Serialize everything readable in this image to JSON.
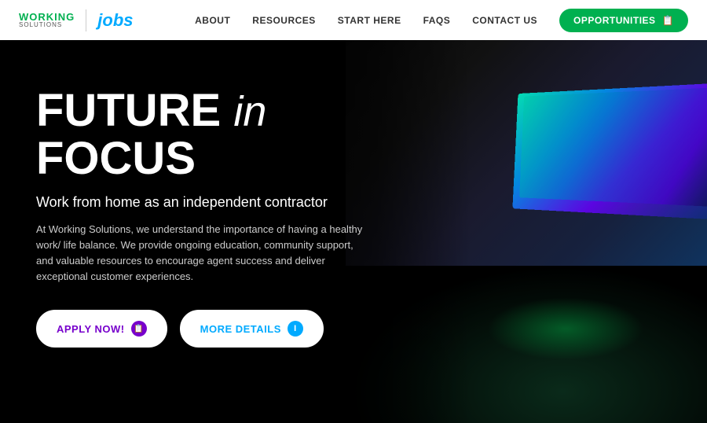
{
  "header": {
    "logo": {
      "working": "WORKING",
      "solutions": "SOLUTIONS",
      "jobs": "jobs"
    },
    "nav": {
      "items": [
        {
          "label": "ABOUT",
          "id": "about"
        },
        {
          "label": "RESOURCES",
          "id": "resources"
        },
        {
          "label": "START HERE",
          "id": "start-here"
        },
        {
          "label": "FAQS",
          "id": "faqs"
        },
        {
          "label": "CONTACT US",
          "id": "contact-us"
        }
      ],
      "cta": {
        "label": "OPPORTUNITIES",
        "icon": "briefcase-icon"
      }
    }
  },
  "hero": {
    "title_part1": "FUTURE",
    "title_in": "in",
    "title_part2": "FOCUS",
    "subtitle": "Work from home as an independent contractor",
    "description": "At Working Solutions, we understand the importance of having a healthy work/ life balance. We provide ongoing education, community support, and valuable resources to encourage agent success and deliver exceptional customer experiences.",
    "buttons": {
      "apply": {
        "label": "APPLY NOW!",
        "icon": "clipboard-icon"
      },
      "details": {
        "label": "MORE DETAILS",
        "icon": "info-icon"
      }
    }
  },
  "colors": {
    "green": "#00b050",
    "blue": "#00aaff",
    "purple": "#7700cc",
    "white": "#ffffff",
    "dark": "#000000"
  }
}
